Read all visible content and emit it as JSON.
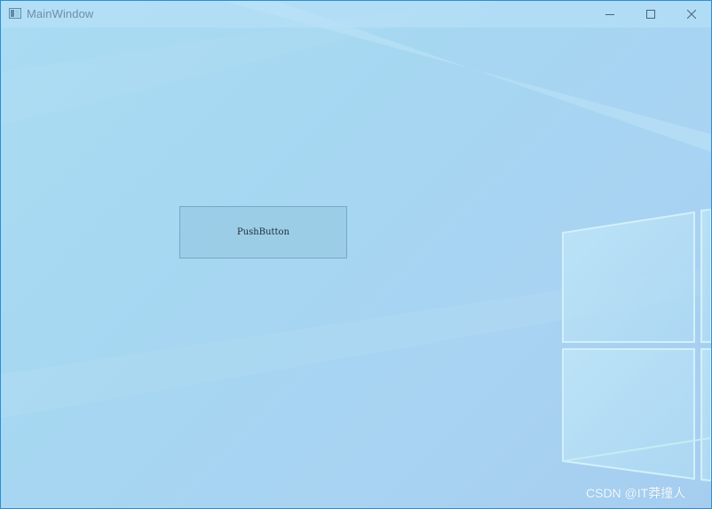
{
  "window": {
    "title": "MainWindow",
    "controls": {
      "minimize_icon": "minimize-icon",
      "maximize_icon": "maximize-icon",
      "close_icon": "close-icon"
    }
  },
  "main": {
    "push_button_label": "PushButton"
  },
  "overlay": {
    "watermark": "CSDN @IT莽撞人"
  },
  "colors": {
    "window_border": "#2b8fd6",
    "background": "#a8d6f2",
    "button_border": "#78a9c4",
    "button_fill": "#9ccbe4"
  }
}
